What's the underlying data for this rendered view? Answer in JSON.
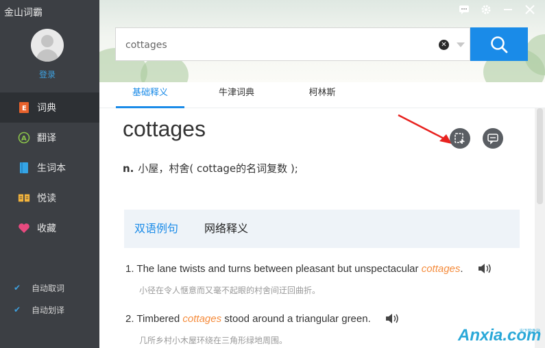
{
  "app": {
    "title": "金山词霸"
  },
  "user": {
    "login_label": "登录"
  },
  "sidebar": {
    "items": [
      {
        "label": "词典",
        "icon": "dictionary-icon",
        "color": "#e8622c"
      },
      {
        "label": "翻译",
        "icon": "translate-icon",
        "color": "#8bc34a"
      },
      {
        "label": "生词本",
        "icon": "wordbook-icon",
        "color": "#35a4e5"
      },
      {
        "label": "悦读",
        "icon": "reading-icon",
        "color": "#f5b53c"
      },
      {
        "label": "收藏",
        "icon": "favorite-icon",
        "color": "#e84a7f"
      }
    ],
    "options": [
      {
        "label": "自动取词",
        "checked": true
      },
      {
        "label": "自动划译",
        "checked": true
      }
    ]
  },
  "search": {
    "value": "cottages",
    "clear_icon": "close-icon",
    "search_icon": "search-icon"
  },
  "tabs": [
    {
      "label": "基础释义"
    },
    {
      "label": "牛津词典"
    },
    {
      "label": "柯林斯"
    }
  ],
  "entry": {
    "word": "cottages",
    "pos": "n.",
    "definition": "小屋，村舍( cottage的名词复数 );"
  },
  "subtabs": [
    {
      "label": "双语例句"
    },
    {
      "label": "网络释义"
    }
  ],
  "examples": [
    {
      "num": "1.",
      "before": "The lane twists and turns between pleasant but unspectacular ",
      "keyword": "cottages",
      "after": ".",
      "translation": "小径在令人惬意而又毫不起眼的村舍间迂回曲折。"
    },
    {
      "num": "2.",
      "before": "Timbered ",
      "keyword": "cottages",
      "after": " stood around a triangular green.",
      "translation": "几所乡村小木屋环绕在三角形绿地周围。"
    }
  ],
  "watermark": {
    "text": "Anxia.com",
    "sub": "安下软件站"
  },
  "colors": {
    "accent": "#1a8be8",
    "sidebar_bg": "#3c3f44",
    "keyword": "#f58b3b",
    "arrow": "#e8221f"
  }
}
